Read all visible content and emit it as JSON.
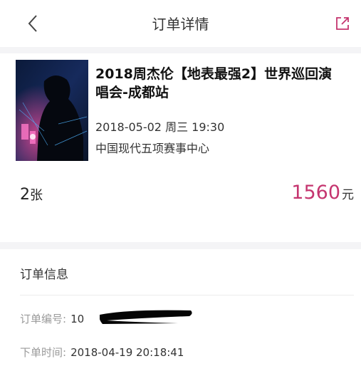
{
  "header": {
    "title": "订单详情",
    "back_icon": "chevron-left-icon",
    "share_icon": "share-icon",
    "share_color": "#c5356f"
  },
  "event": {
    "title": "2018周杰伦【地表最强2】世界巡回演唱会-成都站",
    "datetime": "2018-05-02 周三 19:30",
    "venue": "中国现代五项赛事中心",
    "ticket_count": "2",
    "ticket_unit": "张",
    "price": "1560",
    "price_unit": "元",
    "price_color": "#c5356f"
  },
  "order_info": {
    "heading": "订单信息",
    "order_number_label": "订单编号:",
    "order_number_value": "10",
    "order_time_label": "下单时间:",
    "order_time_value": "2018-04-19 20:18:41"
  }
}
